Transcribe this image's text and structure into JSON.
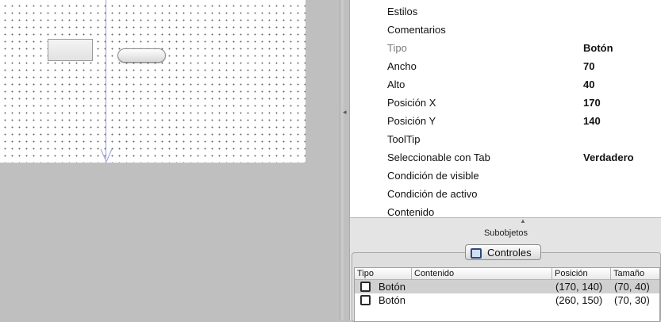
{
  "canvas": {
    "objects": [
      "rectangle",
      "rounded-button"
    ]
  },
  "inspector": {
    "properties": [
      {
        "label": "Estilos",
        "value": "",
        "dim": false
      },
      {
        "label": "Comentarios",
        "value": "",
        "dim": false
      },
      {
        "label": "Tipo",
        "value": "Botón",
        "dim": true
      },
      {
        "label": "Ancho",
        "value": "70",
        "dim": false
      },
      {
        "label": "Alto",
        "value": "40",
        "dim": false
      },
      {
        "label": "Posición X",
        "value": "170",
        "dim": false
      },
      {
        "label": "Posición Y",
        "value": "140",
        "dim": false
      },
      {
        "label": "ToolTip",
        "value": "",
        "dim": false
      },
      {
        "label": "Seleccionable con Tab",
        "value": "Verdadero",
        "dim": false
      },
      {
        "label": "Condición de visible",
        "value": "",
        "dim": false
      },
      {
        "label": "Condición de activo",
        "value": "",
        "dim": false
      },
      {
        "label": "Contenido",
        "value": "",
        "dim": false
      }
    ],
    "subobjects_label": "Subobjetos",
    "tab_label": "Controles",
    "table": {
      "columns": [
        "Tipo",
        "Contenido",
        "Posición",
        "Tamaño"
      ],
      "rows": [
        {
          "tipo": "Botón",
          "contenido": "",
          "posicion": "(170, 140)",
          "tamano": "(70, 40)",
          "selected": true
        },
        {
          "tipo": "Botón",
          "contenido": "",
          "posicion": "(260, 150)",
          "tamano": "(70, 30)",
          "selected": false
        }
      ]
    }
  },
  "colors": {
    "background": "#bfbfbf",
    "selection": "#d0d0d0",
    "guide": "#9b9be0"
  }
}
